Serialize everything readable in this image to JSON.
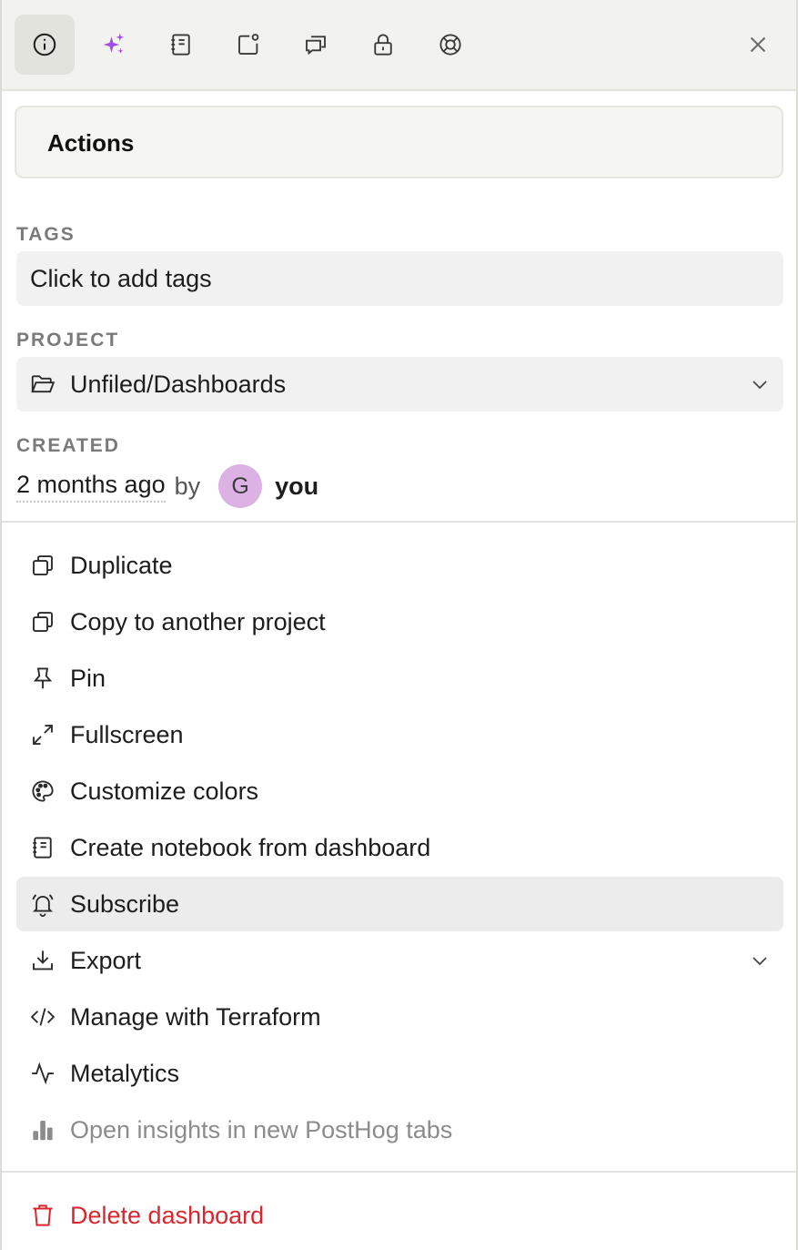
{
  "toolbar": {
    "tabs": [
      {
        "icon": "info-icon",
        "active": true
      },
      {
        "icon": "sparkles-icon",
        "active": false
      },
      {
        "icon": "notebook-icon",
        "active": false
      },
      {
        "icon": "notification-icon",
        "active": false
      },
      {
        "icon": "discussion-icon",
        "active": false
      },
      {
        "icon": "lock-icon",
        "active": false
      },
      {
        "icon": "support-icon",
        "active": false
      }
    ],
    "close_icon": "close-icon"
  },
  "actions": {
    "title": "Actions"
  },
  "tags": {
    "label": "TAGS",
    "placeholder": "Click to add tags"
  },
  "project": {
    "label": "PROJECT",
    "value": "Unfiled/Dashboards"
  },
  "created": {
    "label": "CREATED",
    "time": "2 months ago",
    "by": "by",
    "avatar_letter": "G",
    "user": "you"
  },
  "menu": {
    "duplicate": "Duplicate",
    "copy": "Copy to another project",
    "pin": "Pin",
    "fullscreen": "Fullscreen",
    "customize": "Customize colors",
    "notebook": "Create notebook from dashboard",
    "subscribe": "Subscribe",
    "export": "Export",
    "terraform": "Manage with Terraform",
    "metalytics": "Metalytics",
    "open_insights": "Open insights in new PostHog tabs",
    "delete": "Delete dashboard"
  },
  "colors": {
    "accent_sparkle": "#a24be8",
    "danger": "#d9262c",
    "avatar_bg": "#dcb1e3"
  }
}
